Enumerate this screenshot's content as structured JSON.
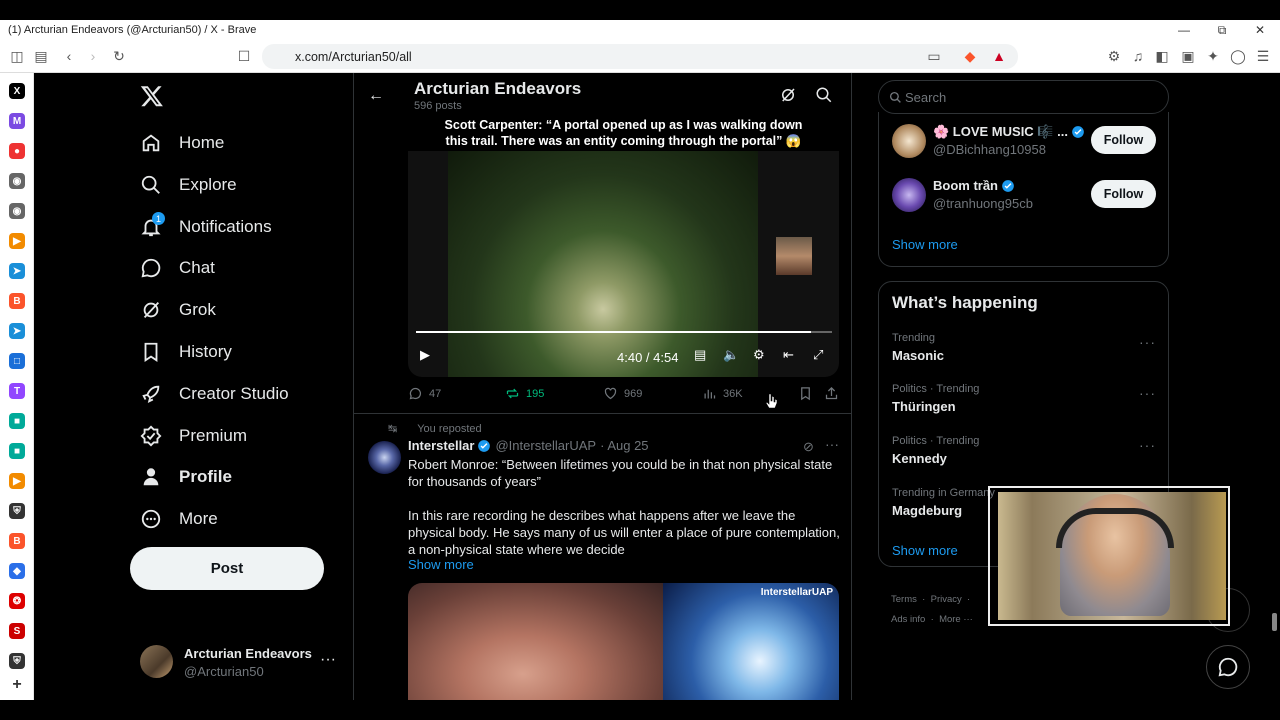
{
  "browser": {
    "title": "(1) Arcturian Endeavors (@Arcturian50) / X - Brave",
    "url": "x.com/Arcturian50/all"
  },
  "nav": {
    "items": [
      {
        "label": "Home",
        "icon": "home-icon"
      },
      {
        "label": "Explore",
        "icon": "search-icon"
      },
      {
        "label": "Notifications",
        "icon": "bell-icon",
        "badge": "1"
      },
      {
        "label": "Chat",
        "icon": "chat-icon"
      },
      {
        "label": "Grok",
        "icon": "grok-icon"
      },
      {
        "label": "History",
        "icon": "bookmark-icon"
      },
      {
        "label": "Creator Studio",
        "icon": "rocket-icon"
      },
      {
        "label": "Premium",
        "icon": "premium-icon"
      },
      {
        "label": "Profile",
        "icon": "person-icon"
      },
      {
        "label": "More",
        "icon": "more-circle-icon"
      }
    ],
    "post_label": "Post"
  },
  "account": {
    "name": "Arcturian Endeavors",
    "handle": "@Arcturian50"
  },
  "header": {
    "title": "Arcturian Endeavors",
    "subtitle": "596 posts"
  },
  "tweet1": {
    "caption_line1": "Scott Carpenter: “A portal opened up as I was walking down",
    "caption_line2": "this trail. There was an entity coming through the portal” 😱",
    "time": "4:40 / 4:54",
    "progress": 0.95,
    "replies": "47",
    "reposts": "195",
    "likes": "969",
    "views": "36K"
  },
  "tweet2": {
    "repost_label": "You reposted",
    "name": "Interstellar",
    "handle": "@InterstellarUAP",
    "date": "· Aug 25",
    "body": "Robert Monroe: “Between lifetimes you could be in that non physical state for thousands of years”\n\nIn this rare recording he describes what happens after we leave the physical body. He says many of us will enter a place of pure contemplation, a non-physical state where we decide",
    "show_more": "Show more",
    "watermark": "InterstellarUAP"
  },
  "right": {
    "search_placeholder": "Search",
    "suggestions": [
      {
        "name": "🌸 LOVE MUSIC 🎼 ...",
        "handle": "@DBichhang10958",
        "follow": "Follow"
      },
      {
        "name": "Boom trần",
        "handle": "@tranhuong95cb",
        "follow": "Follow"
      }
    ],
    "show_more": "Show more",
    "whats_happening": "What’s happening",
    "trends": [
      {
        "context": "Trending",
        "name": "Masonic"
      },
      {
        "context": "Politics · Trending",
        "name": "Thüringen"
      },
      {
        "context": "Politics · Trending",
        "name": "Kennedy"
      },
      {
        "context": "Trending in Germany",
        "name": "Magdeburg"
      }
    ],
    "trends_show_more": "Show more",
    "footer": {
      "terms": "Terms",
      "privacy": "Privacy",
      "ads": "Ads info",
      "more": "More ···"
    }
  },
  "colors": {
    "accent": "#1d9bf0",
    "repost_green": "#00ba7c",
    "muted": "#71767b"
  }
}
